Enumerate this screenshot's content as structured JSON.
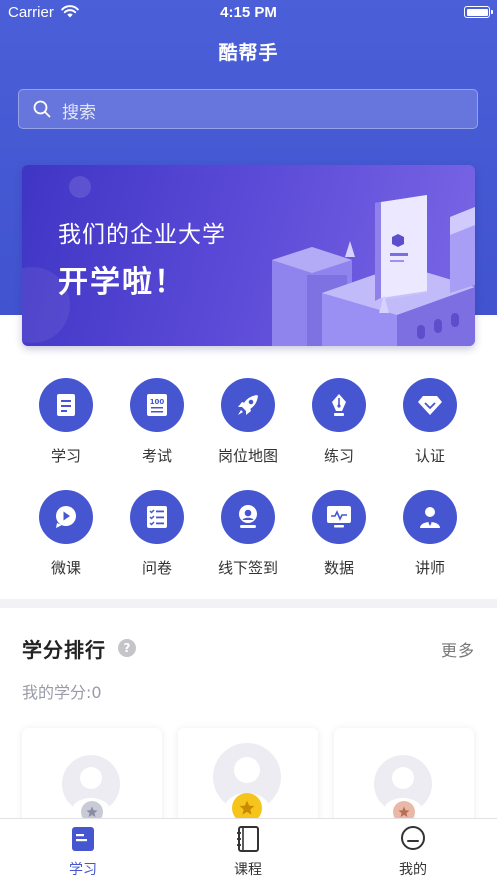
{
  "status_bar": {
    "carrier": "Carrier",
    "time": "4:15 PM"
  },
  "header": {
    "title": "酷帮手"
  },
  "search": {
    "placeholder": "搜索"
  },
  "banner": {
    "line1": "我们的企业大学",
    "line2": "开学啦！"
  },
  "menu": {
    "items": [
      {
        "label": "学习",
        "icon": "document-icon"
      },
      {
        "label": "考试",
        "icon": "exam-icon"
      },
      {
        "label": "岗位地图",
        "icon": "rocket-icon"
      },
      {
        "label": "练习",
        "icon": "pen-icon"
      },
      {
        "label": "认证",
        "icon": "diamond-icon"
      },
      {
        "label": "微课",
        "icon": "play-bubble-icon"
      },
      {
        "label": "问卷",
        "icon": "checklist-icon"
      },
      {
        "label": "线下签到",
        "icon": "location-user-icon"
      },
      {
        "label": "数据",
        "icon": "monitor-icon"
      },
      {
        "label": "讲师",
        "icon": "teacher-icon"
      }
    ]
  },
  "ranking": {
    "title": "学分排行",
    "more": "更多",
    "my_score": "我的学分:0"
  },
  "tabbar": {
    "items": [
      {
        "label": "学习",
        "icon": "book-icon",
        "active": true
      },
      {
        "label": "课程",
        "icon": "notebook-icon",
        "active": false
      },
      {
        "label": "我的",
        "icon": "smile-icon",
        "active": false
      }
    ]
  },
  "colors": {
    "primary": "#4656d0",
    "header_bg": "#4a5fd8",
    "gold_medal": "#f5c51c",
    "silver_medal": "#c8cad6",
    "bronze_medal": "#e9b8a6",
    "tab_inactive": "#333333"
  }
}
